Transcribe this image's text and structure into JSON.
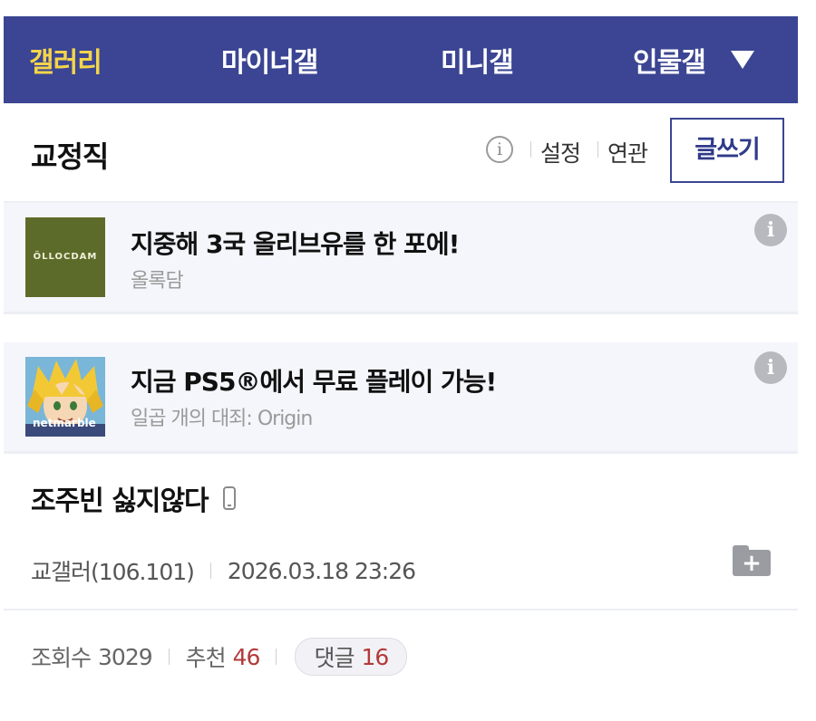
{
  "nav": {
    "items": [
      {
        "label": "갤러리",
        "active": true
      },
      {
        "label": "마이너갤",
        "active": false
      },
      {
        "label": "미니갤",
        "active": false
      },
      {
        "label": "인물갤",
        "active": false
      }
    ],
    "dropdown_icon": "triangle-down-icon",
    "bg_color": "#3b4593",
    "active_color": "#f4d54a"
  },
  "gallery": {
    "title": "교정직",
    "info_icon": "i",
    "settings_label": "설정",
    "related_label": "연관",
    "write_label": "글쓰기"
  },
  "ads": [
    {
      "thumb_text": "ÖLLOCDAM",
      "title": "지중해 3국 올리브유를 한 포에!",
      "sponsor": "올록담",
      "info_icon": "i"
    },
    {
      "thumb_text": "netmarble",
      "title": "지금 PS5®에서 무료 플레이 가능!",
      "sponsor": "일곱 개의 대죄: Origin",
      "info_icon": "i"
    }
  ],
  "post": {
    "title": "조주빈 싫지않다",
    "author": "교갤러(106.101)",
    "datetime": "2026.03.18 23:26",
    "views_label": "조회수",
    "views": "3029",
    "recommend_label": "추천",
    "recommend": "46",
    "comments_label": "댓글",
    "comments": "16",
    "scrap_icon": "+"
  }
}
